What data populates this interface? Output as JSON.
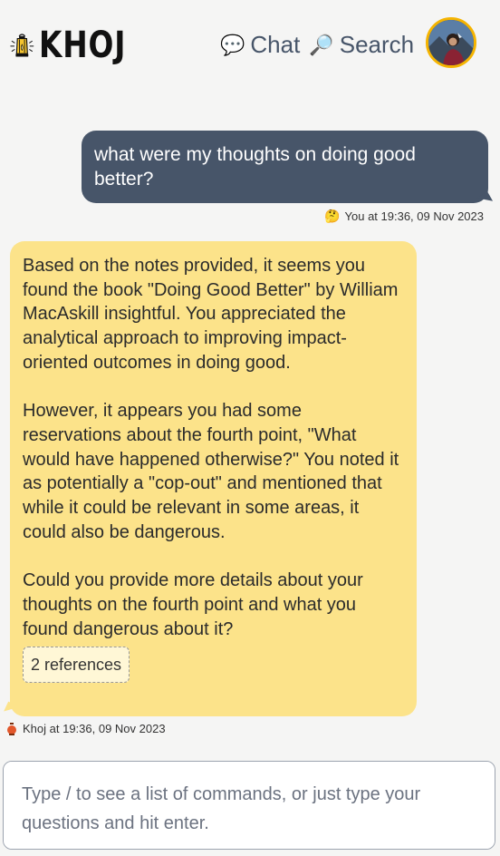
{
  "header": {
    "logo_text": "KHOJ",
    "nav": [
      {
        "icon": "speech-bubble-icon",
        "glyph": "💬",
        "label": "Chat"
      },
      {
        "icon": "magnifier-icon",
        "glyph": "🔎",
        "label": "Search"
      }
    ]
  },
  "conversation": {
    "user_message": {
      "text": "what were my thoughts on doing good better?",
      "emoji": "🤔",
      "meta": "You at 19:36, 09 Nov 2023"
    },
    "khoj_message": {
      "paragraphs": [
        "Based on the notes provided, it seems you found the book \"Doing Good Better\" by William MacAskill insightful. You appreciated the analytical approach to improving impact-oriented outcomes in doing good.",
        "However, it appears you had some reservations about the fourth point, \"What would have happened otherwise?\" You noted it as potentially a \"cop-out\" and mentioned that while it could be relevant in some areas, it could also be dangerous.",
        "Could you provide more details about your thoughts on the fourth point and what you found dangerous about it?"
      ],
      "references_label": "2 references",
      "meta": "Khoj at 19:36, 09 Nov 2023"
    }
  },
  "input": {
    "placeholder": "Type / to see a list of commands, or just type your questions and hit enter.",
    "value": ""
  },
  "colors": {
    "user_bubble": "#475569",
    "khoj_bubble": "#fce38a",
    "avatar_ring": "#f5b400",
    "nav_text": "#475569"
  }
}
